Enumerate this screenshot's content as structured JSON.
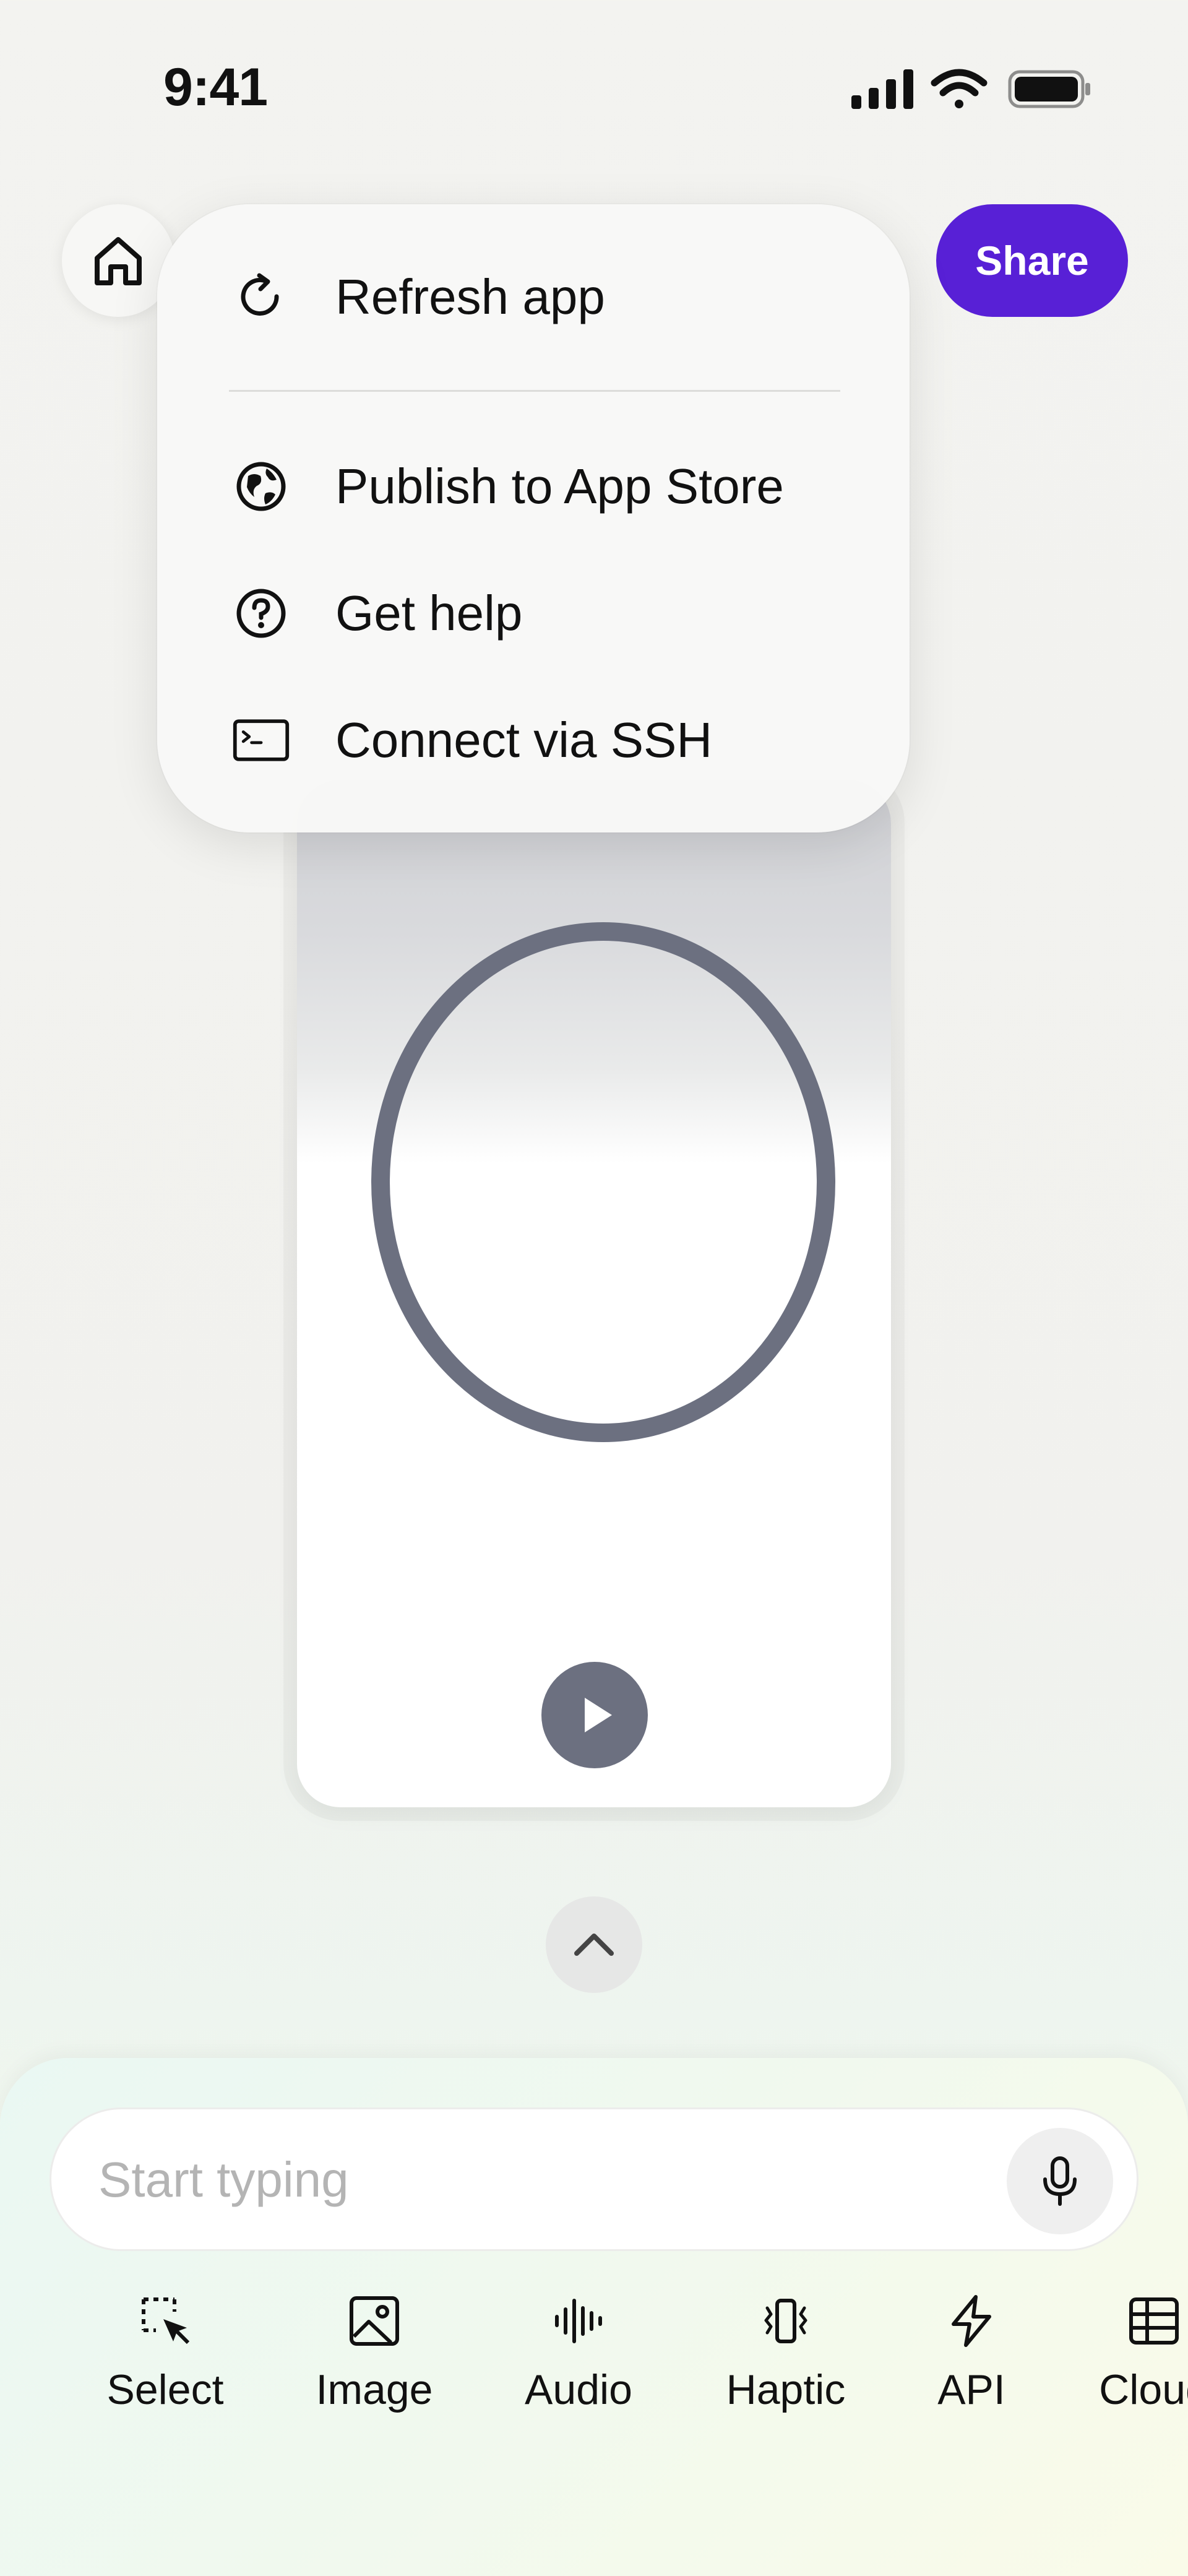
{
  "status_bar": {
    "time": "9:41",
    "icons": [
      "signal-icon",
      "wifi-icon",
      "battery-icon"
    ]
  },
  "header": {
    "home_icon": "home-icon",
    "share_label": "Share",
    "accent": "#5820d6"
  },
  "menu": {
    "items": [
      {
        "label": "Refresh app",
        "icon": "refresh-icon"
      },
      {
        "label": "Publish to App Store",
        "icon": "globe-icon"
      },
      {
        "label": "Get help",
        "icon": "help-icon"
      },
      {
        "label": "Connect via SSH",
        "icon": "terminal-icon"
      }
    ]
  },
  "preview": {
    "circle_color": "#6c7080",
    "play_icon": "play-icon"
  },
  "composer": {
    "placeholder": "Start typing",
    "mic_icon": "microphone-icon",
    "tools": [
      {
        "label": "Select",
        "icon": "select-icon"
      },
      {
        "label": "Image",
        "icon": "image-icon"
      },
      {
        "label": "Audio",
        "icon": "audio-icon"
      },
      {
        "label": "Haptic",
        "icon": "haptic-icon"
      },
      {
        "label": "API",
        "icon": "lightning-icon"
      },
      {
        "label": "Cloud",
        "icon": "table-icon"
      }
    ]
  }
}
